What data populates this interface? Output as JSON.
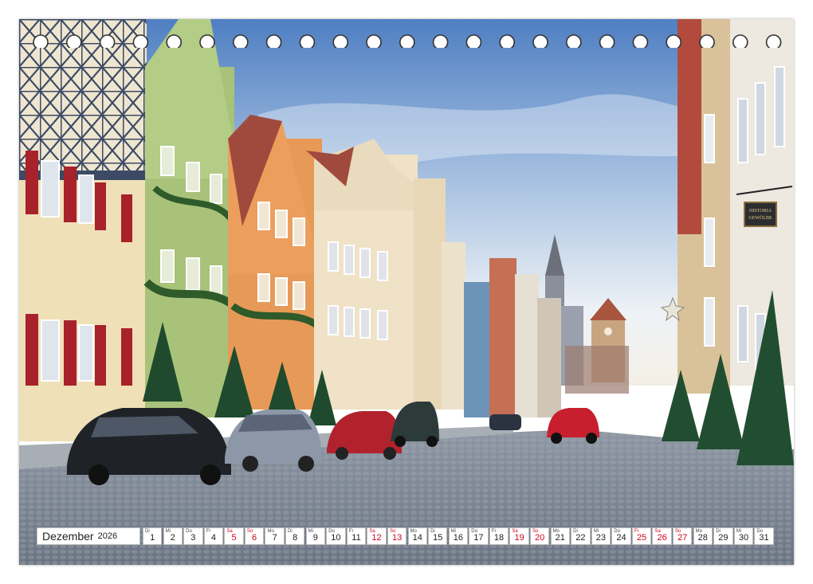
{
  "calendar": {
    "month": "Dezember",
    "year": "2026",
    "days": [
      {
        "dow": "Di",
        "num": "1",
        "red": false
      },
      {
        "dow": "Mi",
        "num": "2",
        "red": false
      },
      {
        "dow": "Do",
        "num": "3",
        "red": false
      },
      {
        "dow": "Fr",
        "num": "4",
        "red": false
      },
      {
        "dow": "Sa",
        "num": "5",
        "red": true
      },
      {
        "dow": "So",
        "num": "6",
        "red": true
      },
      {
        "dow": "Mo",
        "num": "7",
        "red": false
      },
      {
        "dow": "Di",
        "num": "8",
        "red": false
      },
      {
        "dow": "Mi",
        "num": "9",
        "red": false
      },
      {
        "dow": "Do",
        "num": "10",
        "red": false
      },
      {
        "dow": "Fr",
        "num": "11",
        "red": false
      },
      {
        "dow": "Sa",
        "num": "12",
        "red": true
      },
      {
        "dow": "So",
        "num": "13",
        "red": true
      },
      {
        "dow": "Mo",
        "num": "14",
        "red": false
      },
      {
        "dow": "Di",
        "num": "15",
        "red": false
      },
      {
        "dow": "Mi",
        "num": "16",
        "red": false
      },
      {
        "dow": "Do",
        "num": "17",
        "red": false
      },
      {
        "dow": "Fr",
        "num": "18",
        "red": false
      },
      {
        "dow": "Sa",
        "num": "19",
        "red": true
      },
      {
        "dow": "So",
        "num": "20",
        "red": true
      },
      {
        "dow": "Mo",
        "num": "21",
        "red": false
      },
      {
        "dow": "Di",
        "num": "22",
        "red": false
      },
      {
        "dow": "Mi",
        "num": "23",
        "red": false
      },
      {
        "dow": "Do",
        "num": "24",
        "red": false
      },
      {
        "dow": "Fr",
        "num": "25",
        "red": true
      },
      {
        "dow": "Sa",
        "num": "26",
        "red": true
      },
      {
        "dow": "So",
        "num": "27",
        "red": true
      },
      {
        "dow": "Mo",
        "num": "28",
        "red": false
      },
      {
        "dow": "Di",
        "num": "29",
        "red": false
      },
      {
        "dow": "Mi",
        "num": "30",
        "red": false
      },
      {
        "dow": "Do",
        "num": "31",
        "red": false
      }
    ]
  },
  "sign_text": "HISTORIA GEWÖLBE",
  "colors": {
    "weekend_red": "#d0021b",
    "sky_top": "#5b86c4",
    "cobblestone": "#7f8a98"
  }
}
